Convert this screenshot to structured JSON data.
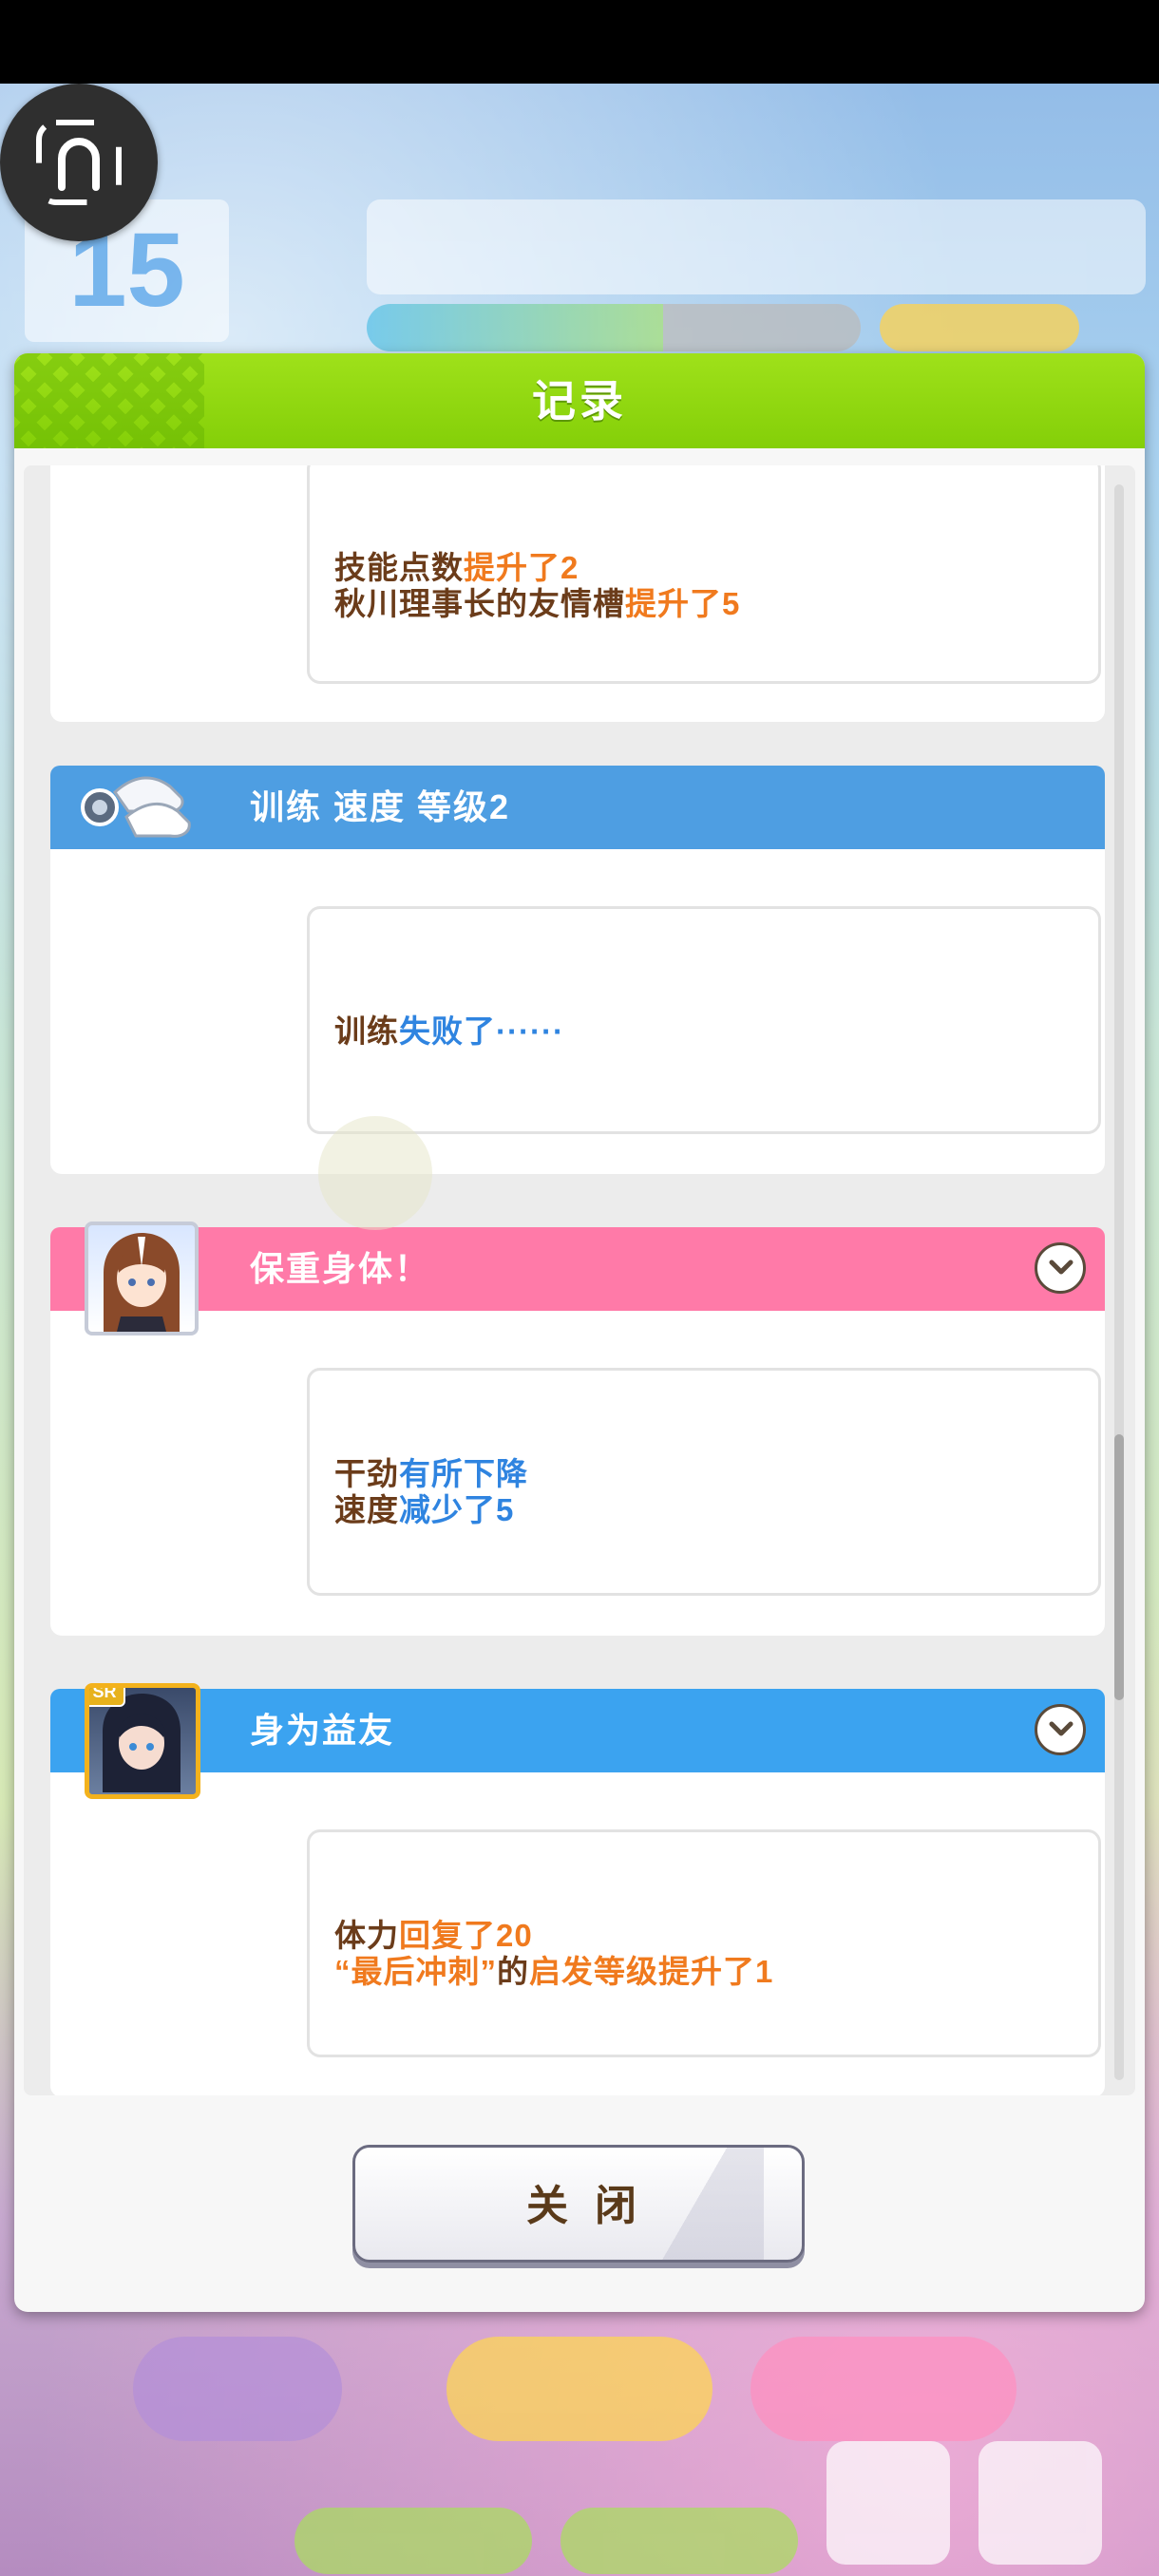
{
  "dialog": {
    "title": "记录",
    "close_label": "关闭"
  },
  "hud": {
    "date": "15"
  },
  "entries": [
    {
      "title": "",
      "lines": [
        {
          "parts": [
            {
              "t": "技能点数",
              "c": "n"
            },
            {
              "t": "提升了2",
              "c": "o"
            }
          ]
        },
        {
          "parts": [
            {
              "t": "秋川理事长的友情槽",
              "c": "n"
            },
            {
              "t": "提升了5",
              "c": "o"
            }
          ]
        }
      ]
    },
    {
      "title": "训练  速度  等级2",
      "icon": "training-shoes-icon",
      "lines": [
        {
          "parts": [
            {
              "t": "训练",
              "c": "n"
            },
            {
              "t": "失败了······",
              "c": "b"
            }
          ]
        }
      ]
    },
    {
      "title": "保重身体！",
      "icon": "character-portrait",
      "lines": [
        {
          "parts": [
            {
              "t": "干劲",
              "c": "n"
            },
            {
              "t": "有所下降",
              "c": "b"
            }
          ]
        },
        {
          "parts": [
            {
              "t": "速度",
              "c": "n"
            },
            {
              "t": "减少了5",
              "c": "b"
            }
          ]
        }
      ]
    },
    {
      "title": "身为益友",
      "icon": "support-card-portrait",
      "badge": "SR",
      "lines": [
        {
          "parts": [
            {
              "t": "体力",
              "c": "n"
            },
            {
              "t": "回复了20",
              "c": "o"
            }
          ]
        },
        {
          "parts": [
            {
              "t": "“最后冲刺”",
              "c": "o"
            },
            {
              "t": "的",
              "c": "n"
            },
            {
              "t": "启发等级提升了1",
              "c": "o"
            }
          ]
        }
      ]
    }
  ],
  "colors": {
    "header_green": "#8fd80f",
    "blue_header": "#4e9ee2",
    "pink_header": "#ff7aa8",
    "sky_header": "#3ba3f0",
    "text_brown": "#6b3c1a",
    "text_orange": "#f07a1e",
    "text_blue": "#2f84e0"
  }
}
